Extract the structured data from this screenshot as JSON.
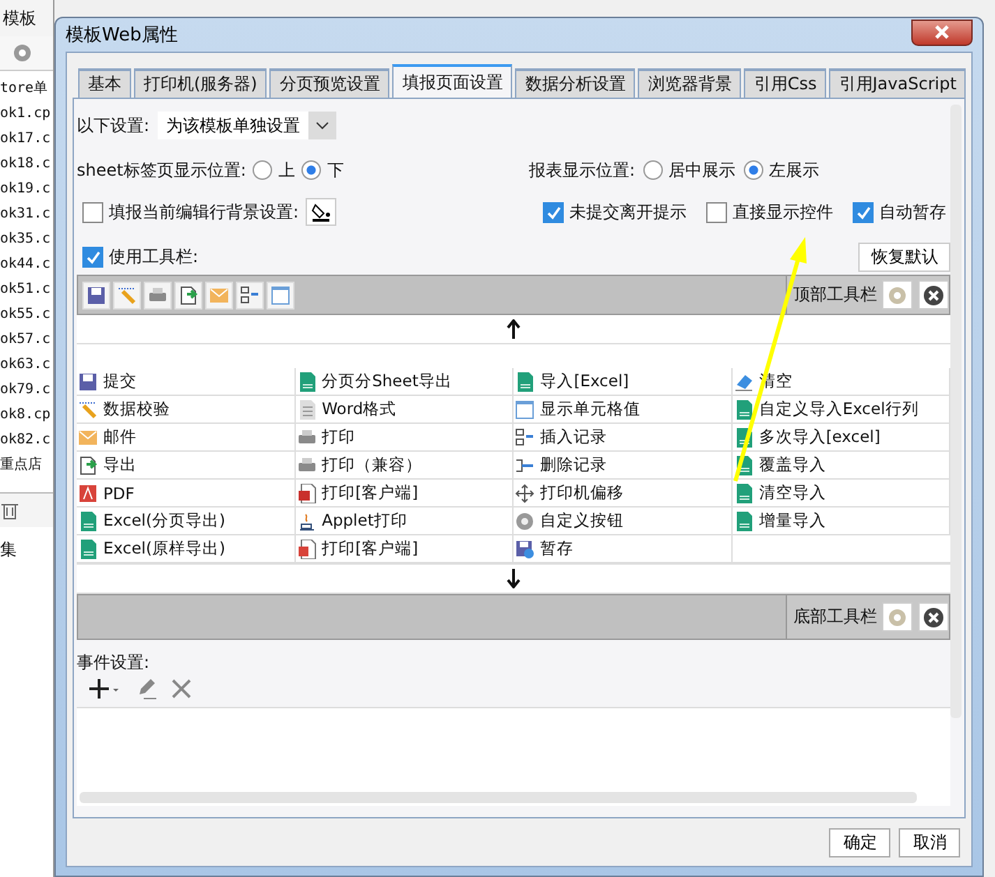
{
  "background_app": {
    "menu": [
      "模板"
    ],
    "files": [
      "tore单",
      "ok1.cp",
      "ok17.c",
      "ok18.c",
      "ok19.c",
      "ok31.c",
      "ok35.c",
      "ok44.c",
      "ok51.c",
      "ok55.c",
      "ok57.c",
      "ok63.c",
      "ok79.c",
      "ok8.cp",
      "ok82.c",
      "重点店"
    ],
    "panel_label": "集"
  },
  "dialog": {
    "title": "模板Web属性"
  },
  "tabs": [
    {
      "label": "基本",
      "selected": false
    },
    {
      "label": "打印机(服务器)",
      "selected": false
    },
    {
      "label": "分页预览设置",
      "selected": false
    },
    {
      "label": "填报页面设置",
      "selected": true
    },
    {
      "label": "数据分析设置",
      "selected": false
    },
    {
      "label": "浏览器背景",
      "selected": false
    },
    {
      "label": "引用Css",
      "selected": false
    },
    {
      "label": "引用JavaScript",
      "selected": false
    }
  ],
  "scope": {
    "label": "以下设置:",
    "value": "为该模板单独设置"
  },
  "sheet_position": {
    "label": "sheet标签页显示位置:",
    "options": [
      {
        "label": "上",
        "selected": false
      },
      {
        "label": "下",
        "selected": true
      }
    ]
  },
  "report_position": {
    "label": "报表显示位置:",
    "options": [
      {
        "label": "居中展示",
        "selected": false
      },
      {
        "label": "左展示",
        "selected": true
      }
    ]
  },
  "edit_row_background": {
    "label": "填报当前编辑行背景设置:",
    "checked": false
  },
  "options": [
    {
      "label": "未提交离开提示",
      "checked": true
    },
    {
      "label": "直接显示控件",
      "checked": false
    },
    {
      "label": "自动暂存",
      "checked": true
    }
  ],
  "use_toolbar": {
    "label": "使用工具栏:",
    "checked": true
  },
  "restore_button": "恢复默认",
  "top_toolbar": {
    "label": "顶部工具栏",
    "buttons": [
      {
        "kind": "save"
      },
      {
        "kind": "check"
      },
      {
        "kind": "print"
      },
      {
        "kind": "export"
      },
      {
        "kind": "mail"
      },
      {
        "kind": "insert"
      },
      {
        "kind": "cellvalue"
      }
    ]
  },
  "button_list": [
    {
      "label": "提交",
      "kind": "save"
    },
    {
      "label": "分页分Sheet导出",
      "kind": "excel"
    },
    {
      "label": "导入[Excel]",
      "kind": "excel"
    },
    {
      "label": "清空",
      "kind": "eraser"
    },
    {
      "label": "数据校验",
      "kind": "check"
    },
    {
      "label": "Word格式",
      "kind": "word"
    },
    {
      "label": "显示单元格值",
      "kind": "cellvalue"
    },
    {
      "label": "自定义导入Excel行列",
      "kind": "excel"
    },
    {
      "label": "邮件",
      "kind": "mail"
    },
    {
      "label": "打印",
      "kind": "print"
    },
    {
      "label": "插入记录",
      "kind": "insert"
    },
    {
      "label": "多次导入[excel]",
      "kind": "excel"
    },
    {
      "label": "导出",
      "kind": "export"
    },
    {
      "label": "打印（兼容）",
      "kind": "print"
    },
    {
      "label": "删除记录",
      "kind": "delete"
    },
    {
      "label": "覆盖导入",
      "kind": "excel"
    },
    {
      "label": "PDF",
      "kind": "pdf"
    },
    {
      "label": "打印[客户端]",
      "kind": "flash"
    },
    {
      "label": "打印机偏移",
      "kind": "move"
    },
    {
      "label": "清空导入",
      "kind": "excel"
    },
    {
      "label": "Excel(分页导出)",
      "kind": "excel"
    },
    {
      "label": "Applet打印",
      "kind": "applet"
    },
    {
      "label": "自定义按钮",
      "kind": "gear"
    },
    {
      "label": "增量导入",
      "kind": "excel"
    },
    {
      "label": "Excel(原样导出)",
      "kind": "excel"
    },
    {
      "label": "打印[客户端]",
      "kind": "pdfdoc"
    },
    {
      "label": "暂存",
      "kind": "savetime"
    }
  ],
  "bottom_toolbar": {
    "label": "底部工具栏"
  },
  "events": {
    "label": "事件设置:"
  },
  "footer_buttons": [
    "确定",
    "取消"
  ]
}
